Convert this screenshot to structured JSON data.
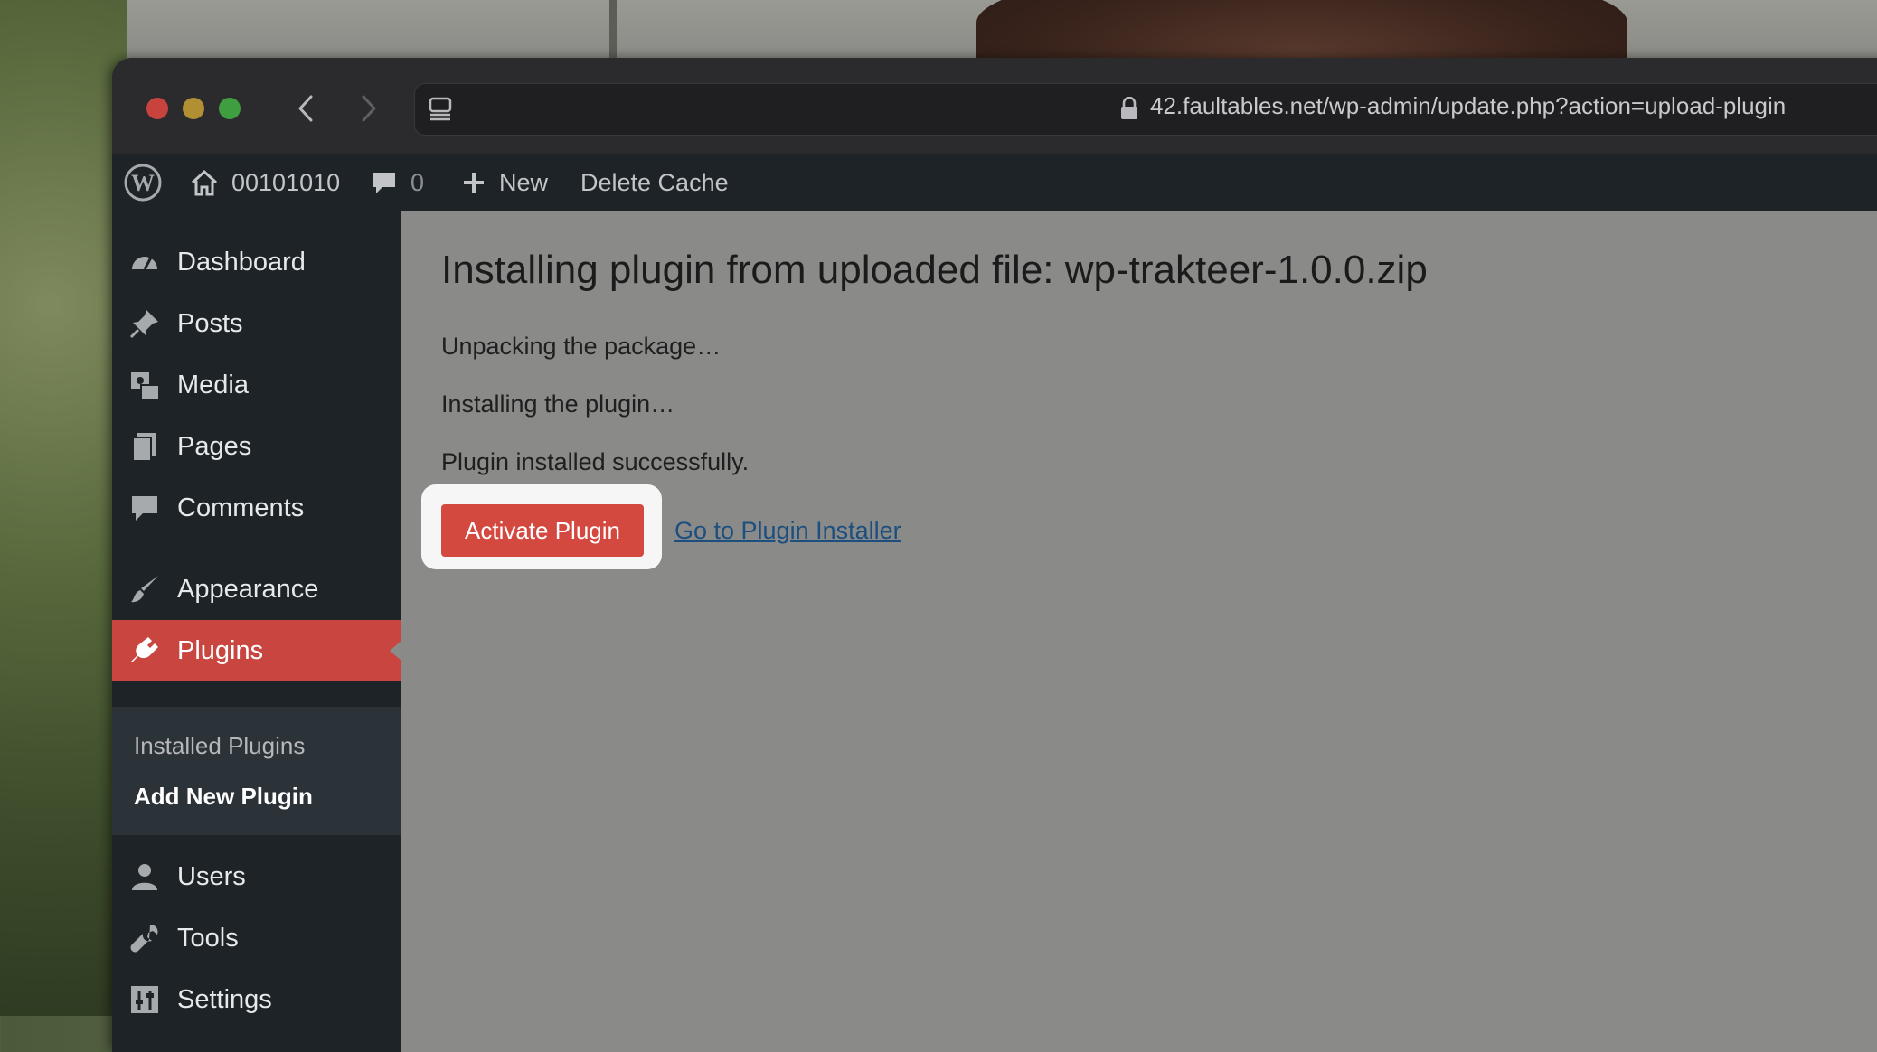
{
  "browser": {
    "url": "42.faultables.net/wp-admin/update.php?action=upload-plugin"
  },
  "admin_bar": {
    "site_name": "00101010",
    "comments_count": "0",
    "new_label": "New",
    "delete_cache_label": "Delete Cache"
  },
  "menu": {
    "items": [
      {
        "label": "Dashboard",
        "icon": "dashboard-icon"
      },
      {
        "label": "Posts",
        "icon": "pin-icon"
      },
      {
        "label": "Media",
        "icon": "media-icon"
      },
      {
        "label": "Pages",
        "icon": "pages-icon"
      },
      {
        "label": "Comments",
        "icon": "comment-icon"
      },
      {
        "label": "Appearance",
        "icon": "brush-icon"
      },
      {
        "label": "Plugins",
        "icon": "plug-icon"
      },
      {
        "label": "Users",
        "icon": "user-icon"
      },
      {
        "label": "Tools",
        "icon": "wrench-icon"
      },
      {
        "label": "Settings",
        "icon": "settings-icon"
      }
    ],
    "submenu": {
      "installed": "Installed Plugins",
      "add_new": "Add New Plugin"
    }
  },
  "content": {
    "title": "Installing plugin from uploaded file: wp-trakteer-1.0.0.zip",
    "status_lines": [
      "Unpacking the package…",
      "Installing the plugin…",
      "Plugin installed successfully."
    ],
    "activate_label": "Activate Plugin",
    "installer_link": "Go to Plugin Installer"
  },
  "colors": {
    "admin_dark": "#1d2327",
    "active_menu": "#c9453f",
    "button": "#d4493f",
    "link": "#1c4f80"
  }
}
